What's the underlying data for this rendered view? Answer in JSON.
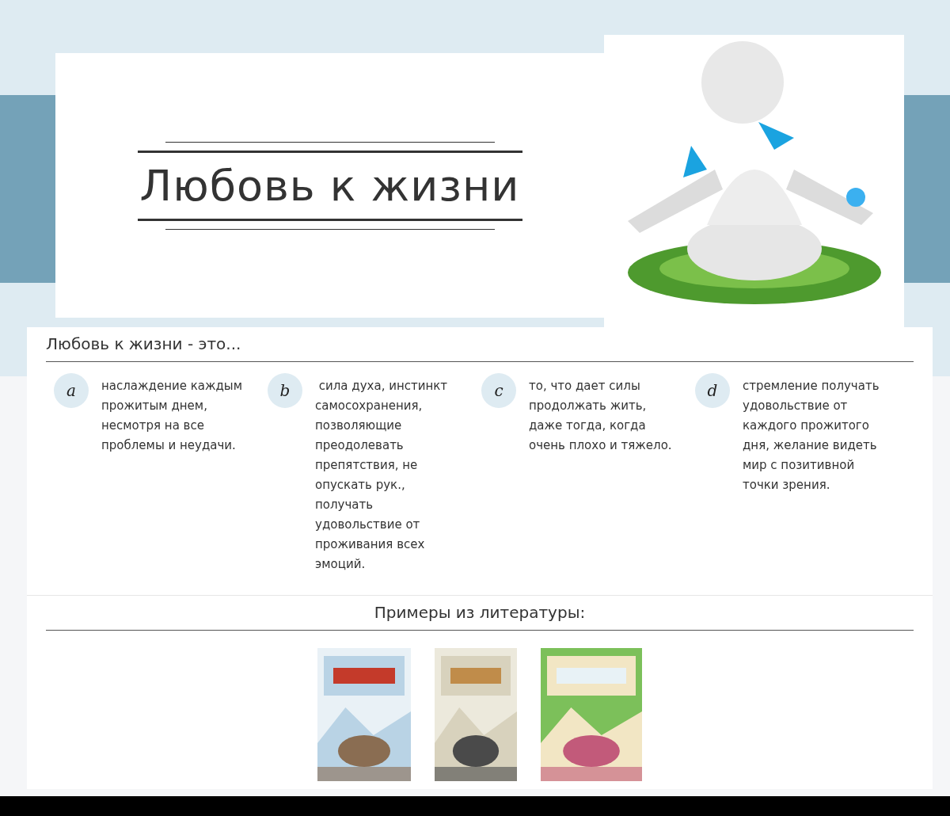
{
  "hero": {
    "title": "Любовь к жизни"
  },
  "definition": {
    "heading": "Любовь к жизни - это...",
    "items": [
      {
        "letter": "a",
        "text": "наслаждение каждым прожитым днем, несмотря на все проблемы и неудачи."
      },
      {
        "letter": "b",
        "text": " сила духа, инстинкт самосохранения, позволяющие преодолевать препятствия, не опускать рук., получать удовольствие от проживания всех эмоций."
      },
      {
        "letter": "c",
        "text": "то, что дает силы продолжать жить, даже тогда, когда очень плохо и тяжело."
      },
      {
        "letter": "d",
        "text": "стремление получать удовольствие от каждого прожитого дня, желание видеть мир с позитивной точки зрения."
      }
    ]
  },
  "literature": {
    "heading": "Примеры из литературы:"
  }
}
